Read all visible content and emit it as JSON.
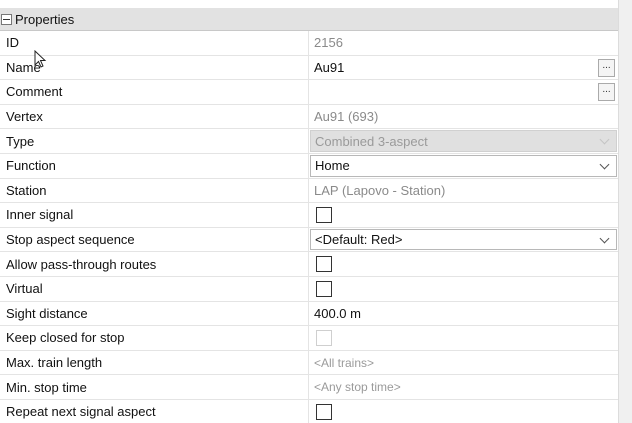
{
  "section": {
    "title": "Properties"
  },
  "rows": [
    {
      "name": "ID",
      "value": "2156"
    },
    {
      "name": "Name",
      "value": "Au91",
      "button": "..."
    },
    {
      "name": "Comment",
      "value": "",
      "button": "..."
    },
    {
      "name": "Vertex",
      "value": "Au91 (693)"
    },
    {
      "name": "Type",
      "value": "Combined 3-aspect"
    },
    {
      "name": "Function",
      "value": "Home"
    },
    {
      "name": "Station",
      "value": "LAP (Lapovo - Station)"
    },
    {
      "name": "Inner signal",
      "checked": false
    },
    {
      "name": "Stop aspect sequence",
      "value": "<Default: Red>"
    },
    {
      "name": "Allow pass-through routes",
      "checked": false
    },
    {
      "name": "Virtual",
      "checked": false
    },
    {
      "name": "Sight distance",
      "value": "400.0 m"
    },
    {
      "name": "Keep closed for stop",
      "checked": false
    },
    {
      "name": "Max. train length",
      "value": "<All trains>"
    },
    {
      "name": "Min. stop time",
      "value": "<Any stop time>"
    },
    {
      "name": "Repeat next signal aspect",
      "checked": false
    }
  ]
}
